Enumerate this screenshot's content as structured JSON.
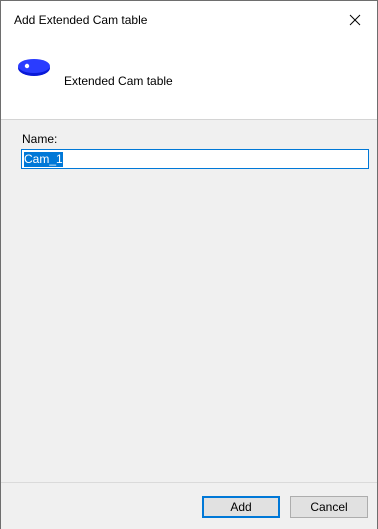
{
  "window": {
    "title": "Add Extended Cam table"
  },
  "header": {
    "icon": "cam-icon",
    "label": "Extended Cam table"
  },
  "form": {
    "name_label": "Name:",
    "name_value": "Cam_1"
  },
  "footer": {
    "add_label": "Add",
    "cancel_label": "Cancel"
  },
  "colors": {
    "accent": "#0078d7",
    "cam_icon": "#0a1ad8"
  }
}
